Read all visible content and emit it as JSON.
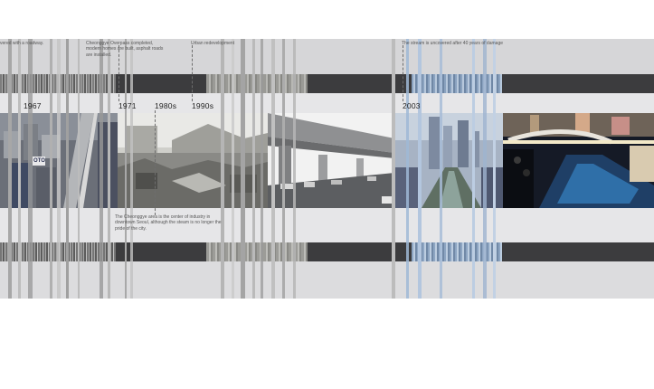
{
  "timeline": {
    "years": [
      {
        "label": "1967"
      },
      {
        "label": "1971"
      },
      {
        "label": "1980s"
      },
      {
        "label": "1990s"
      },
      {
        "label": "2003"
      }
    ],
    "notes": {
      "roadway": "vered with a roadway.",
      "overpass": "Cheonggye Overpass completed, modern homes are built, asphalt roads are installed.",
      "redevelopment": "Urban redevelopment",
      "uncovered": "The stream is uncovered after 40 years of damage",
      "industry": "The Cheonggye area is the center of industry in downtown Seoul, although the steam is no longer the pride of the city."
    },
    "photos": [
      {
        "name": "city-aerial-1967",
        "caption_glyph": "OTO"
      },
      {
        "name": "shantytown-1980s"
      },
      {
        "name": "overpass-1990s"
      },
      {
        "name": "construction-2003"
      },
      {
        "name": "restored-stream-night"
      }
    ]
  },
  "colors": {
    "band_gray": "#d6d6d8",
    "band_dark": "#3c3c3e",
    "band_light": "#e6e6e8",
    "accent_blue": "#9fb8d6"
  }
}
